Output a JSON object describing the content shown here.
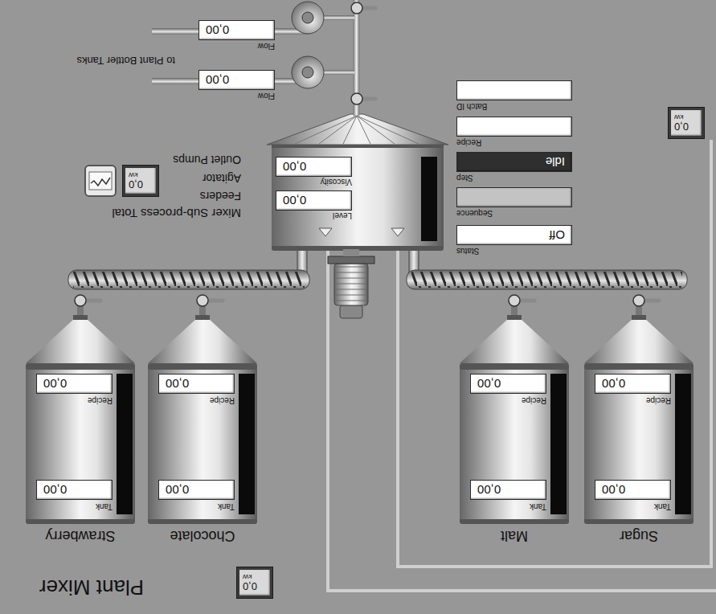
{
  "window": {
    "title": "Plant Mixer"
  },
  "plant_power": {
    "value": "0,0",
    "unit": "kW"
  },
  "side_power": {
    "value": "0,0",
    "unit": "kW"
  },
  "silos": [
    {
      "name": "Sugar",
      "tank_label": "Tank",
      "tank": "0,00",
      "recipe_label": "Recipe",
      "recipe": "0,00",
      "level": 0
    },
    {
      "name": "Malt",
      "tank_label": "Tank",
      "tank": "0,00",
      "recipe_label": "Recipe",
      "recipe": "0,00",
      "level": 0
    },
    {
      "name": "Chocolate",
      "tank_label": "Tank",
      "tank": "0,00",
      "recipe_label": "Recipe",
      "recipe": "0,00",
      "level": 0
    },
    {
      "name": "Strawberry",
      "tank_label": "Tank",
      "tank": "0,00",
      "recipe_label": "Recipe",
      "recipe": "0,00",
      "level": 0
    }
  ],
  "mixer": {
    "level_label": "Level",
    "level": "0,00",
    "viscosity_label": "Viscosity",
    "viscosity": "0,00",
    "fill_level": 0
  },
  "batch": {
    "fields": [
      {
        "label": "Status",
        "value": "Off",
        "kind": "plain"
      },
      {
        "label": "Sequence",
        "value": "",
        "kind": "shaded"
      },
      {
        "label": "Step",
        "value": "Idle",
        "kind": "dark"
      },
      {
        "label": "Recipe",
        "value": "",
        "kind": "plain"
      },
      {
        "label": "Batch ID",
        "value": "",
        "kind": "plain"
      }
    ]
  },
  "subprocess": {
    "title": "Mixer Sub-process Total",
    "items": [
      "Feeders",
      "Agitator",
      "Outlet Pumps"
    ],
    "power": {
      "value": "0,0",
      "unit": "kW"
    }
  },
  "outlet": {
    "destination": "to Plant Bottler Tanks",
    "pumps": [
      {
        "flow_label": "Flow",
        "flow": "0,00"
      },
      {
        "flow_label": "Flow",
        "flow": "0,00"
      }
    ]
  }
}
